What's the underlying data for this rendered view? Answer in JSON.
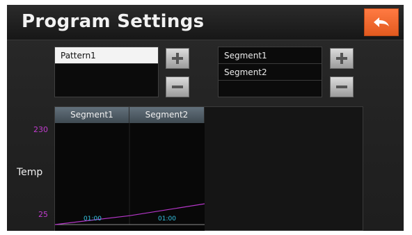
{
  "header": {
    "title": "Program Settings",
    "back_icon": "return-arrow-icon"
  },
  "patterns": {
    "items": [
      {
        "label": "Pattern1",
        "selected": true
      }
    ]
  },
  "segments": {
    "items": [
      {
        "label": "Segment1"
      },
      {
        "label": "Segment2"
      }
    ]
  },
  "buttons": {
    "add_icon": "plus-icon",
    "remove_icon": "minus-icon"
  },
  "chart_data": {
    "type": "line",
    "categories": [
      "Segment1",
      "Segment2"
    ],
    "durations": [
      "01:00",
      "01:00"
    ],
    "ylabel": "Temp",
    "ylim": [
      25,
      230
    ],
    "y_ticks": [
      "230",
      "25"
    ],
    "series": [
      {
        "values": [
          25,
          43,
          67
        ]
      }
    ],
    "colors": {
      "line": "#b536c9",
      "tick_y": "#c23ccf",
      "tick_x": "#35c6e6"
    }
  }
}
